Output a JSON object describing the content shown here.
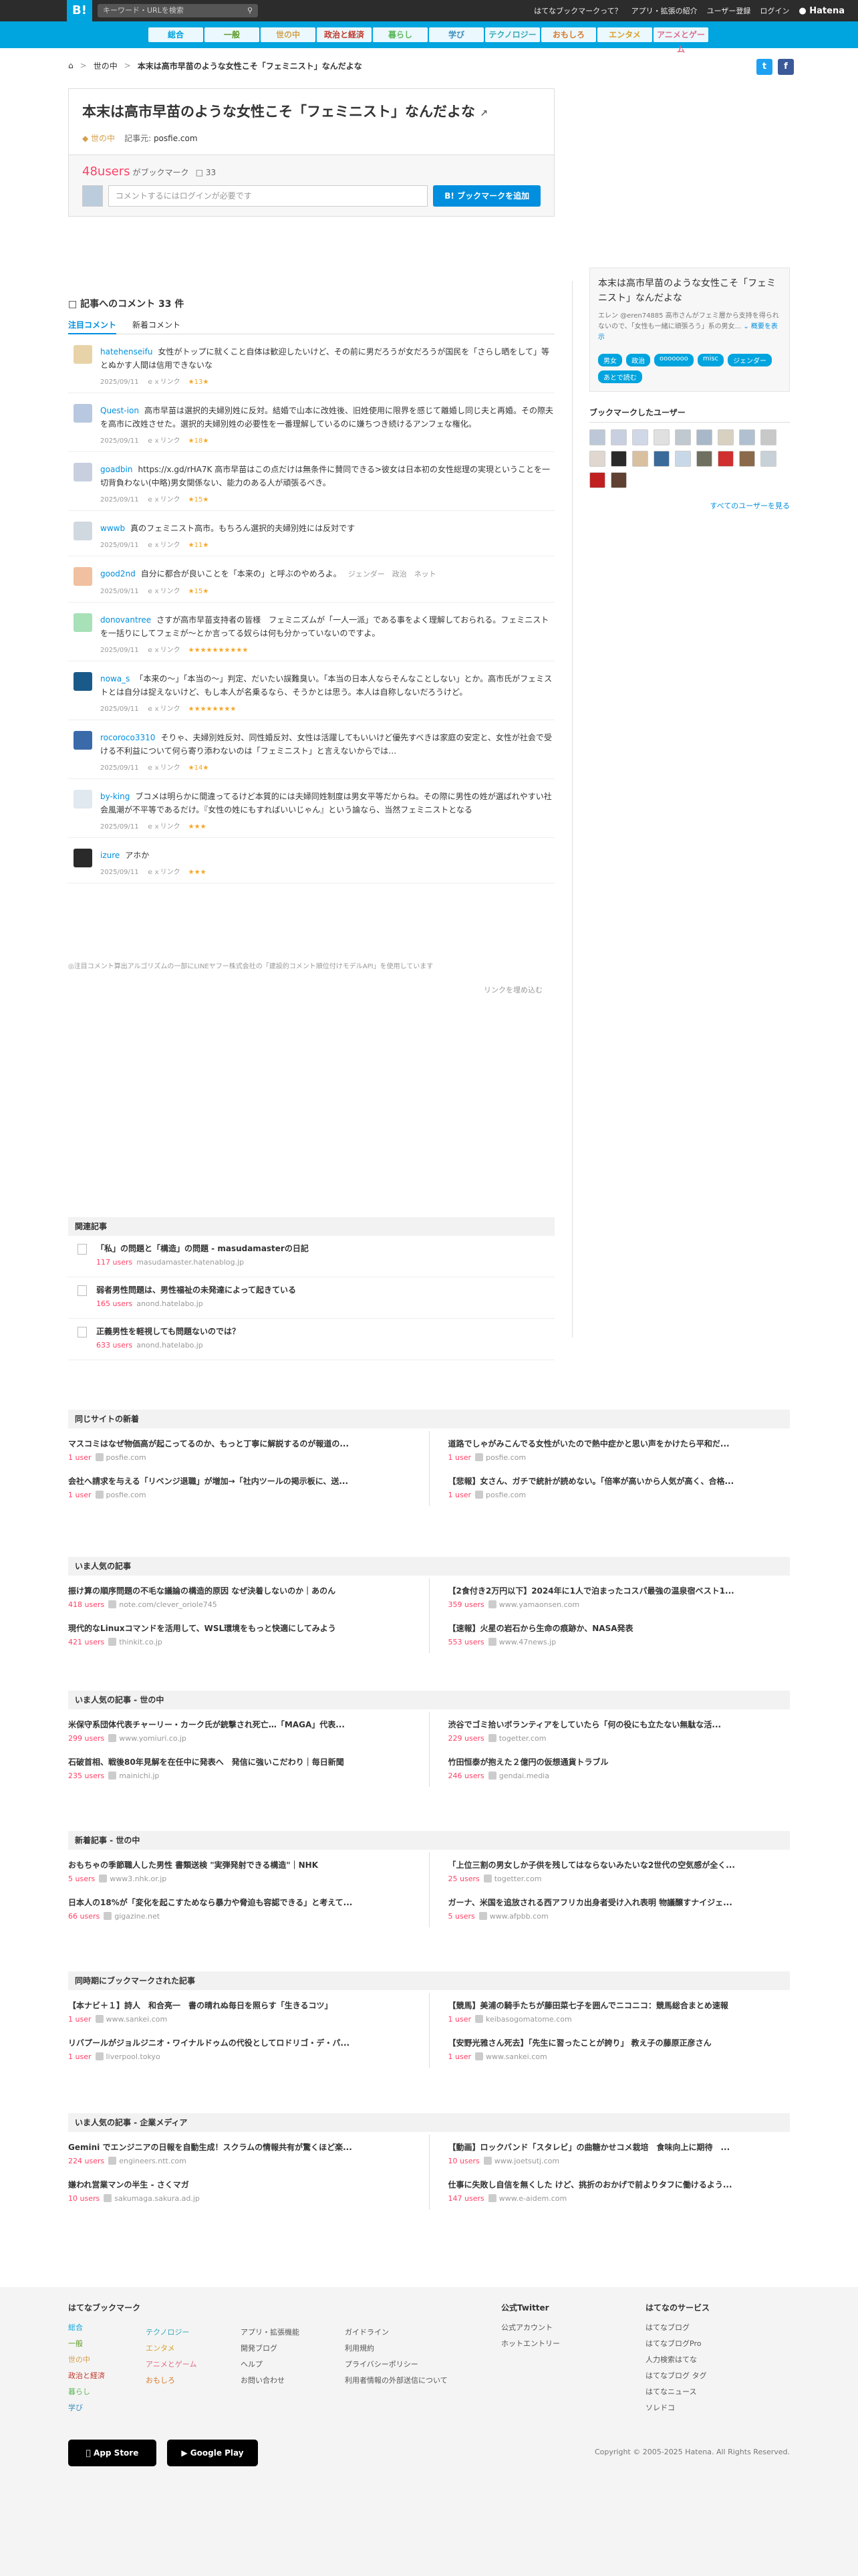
{
  "topbar": {
    "logo": "B!",
    "search_placeholder": "キーワード・URLを検索",
    "links": [
      "はてなブックマークって？",
      "アプリ・拡張の紹介",
      "ユーザー登録",
      "ログイン"
    ],
    "hatena": "Hatena"
  },
  "categories": [
    "総合",
    "一般",
    "世の中",
    "政治と経済",
    "暮らし",
    "学び",
    "テクノロジー",
    "おもしろ",
    "エンタメ",
    "アニメとゲーム"
  ],
  "category_colors": [
    "#00a4de",
    "#5b9a23",
    "#d4a04b",
    "#c0392b",
    "#5cb85c",
    "#3c8dbc",
    "#37a9b8",
    "#d97a2b",
    "#d9a12b",
    "#e06c8c"
  ],
  "breadcrumb": {
    "parent": "世の中",
    "title": "本末は高市早苗のような女性こそ「フェミニスト」なんだよな"
  },
  "entry": {
    "title": "本末は高市早苗のような女性こそ「フェミニスト」なんだよな",
    "category": "世の中",
    "kiji": "記事元:",
    "domain": "posfie.com",
    "users": "48users",
    "users_label": "がブックマーク",
    "comments_count": "33",
    "comment_placeholder": "コメントするにはログインが必要です",
    "add_button": "B! ブックマークを追加"
  },
  "comments_section": {
    "heading": "記事へのコメント",
    "count": "33 件",
    "tabs": [
      "注目コメント",
      "新着コメント"
    ]
  },
  "comments": [
    {
      "user": "hatehenseifu",
      "text": "女性がトップに就くこと自体は歓迎したいけど、その前に男だろうが女だろうが国民を「さらし晒をして」等とぬかす人間は信用できないな",
      "date": "2025/09/11",
      "stars": "★13★",
      "color": "#e8d3a8"
    },
    {
      "user": "Quest-ion",
      "text": "高市早苗は選択的夫婦別姓に反対。結婚で山本に改姓後、旧姓使用に限界を感じて離婚し同じ夫と再婚。その際夫を高市に改姓させた。選択的夫婦別姓の必要性を一番理解しているのに嫌ちつき続けるアンフェな権化。",
      "date": "2025/09/11",
      "stars": "★18★",
      "color": "#b8c8e0"
    },
    {
      "user": "goadbin",
      "text": "https://x.gd/rHA7K 高市早苗はこの点だけは無条件に賛同できる>彼女は日本初の女性総理の実現ということを一切背負わない(中略)男女関係ない、能力のある人が頑張るべき。",
      "date": "2025/09/11",
      "stars": "★15★",
      "color": "#c8d0e0"
    },
    {
      "user": "wwwb",
      "text": "真のフェミニスト高市。もちろん選択的夫婦別姓には反対です",
      "date": "2025/09/11",
      "stars": "★11★",
      "color": "#d0d8e0"
    },
    {
      "user": "good2nd",
      "text": "自分に都合が良いことを「本来の」と呼ぶのやめろよ。",
      "date": "2025/09/11",
      "stars": "★15★",
      "color": "#f0c0a0",
      "tags": "ジェンダー　政治　ネット"
    },
    {
      "user": "donovantree",
      "text": "さすが高市早苗支持者の皆様　フェミニズムが「一人一派」である事をよく理解しておられる。フェミニストを一括りにしてフェミが〜とか言ってる奴らは何も分かっていないのですよ。",
      "date": "2025/09/11",
      "stars": "★★★★★★★★★★",
      "color": "#a8e0b8"
    },
    {
      "user": "nowa_s",
      "text": "「本来の～」「本当の～」判定、だいたい誤難臭い。「本当の日本人ならそんなことしない」とか。高市氏がフェミストとは自分は捉えないけど、もし本人が名乗るなら、そうかとは思う。本人は自称しないだろうけど。",
      "date": "2025/09/11",
      "stars": "★★★★★★★★",
      "color": "#1a5a8a"
    },
    {
      "user": "rocoroco3310",
      "text": "そりゃ、夫婦別姓反対、同性婚反対、女性は活躍してもいいけど優先すべきは家庭の安定と、女性が社会で受ける不利益について何ら寄り添わないのは「フェミニスト」と言えないからでは…",
      "date": "2025/09/11",
      "stars": "★14★",
      "color": "#3a6aaa"
    },
    {
      "user": "by-king",
      "text": "ブコメは明らかに間違ってるけど本質的には夫婦同姓制度は男女平等だからね。その際に男性の姓が選ばれやすい社会風潮が不平等であるだけ。『女性の姓にもすればいいじゃん』という論なら、当然フェミニストとなる",
      "date": "2025/09/11",
      "stars": "★★★",
      "color": "#e0e8f0"
    },
    {
      "user": "izure",
      "text": "アホか",
      "date": "2025/09/11",
      "stars": "★★★",
      "color": "#2a2a2a"
    }
  ],
  "comment_link_label": "ｅｘリンク",
  "algo_note": "◎注目コメント算出アルゴリズムの一部にLINEヤフー株式会社の「建設的コメント順位付けモデルAPI」を使用しています",
  "more_comments": "リンクを埋め込む",
  "related": {
    "heading": "関連記事",
    "items": [
      {
        "title": "「私」の問題と「構造」の問題 - masudamasterの日記",
        "users": "117 users",
        "domain": "masudamaster.hatenablog.jp"
      },
      {
        "title": "弱者男性問題は、男性福祉の未発達によって起きている",
        "users": "165 users",
        "domain": "anond.hatelabo.jp"
      },
      {
        "title": "正義男性を軽視しても問題ないのでは？",
        "users": "633 users",
        "domain": "anond.hatelabo.jp"
      }
    ]
  },
  "sidebar": {
    "title": "本末は高市早苗のような女性こそ「フェミニスト」なんだよな",
    "desc": "エレン @eren74885 高市さんがフェミ層から支持を得られないので、「女性も一緒に頑張ろう」系の男女...",
    "desc_more": "概要を表示",
    "tags": [
      "男女",
      "政治",
      "ooooooo",
      "misc",
      "ジェンダー",
      "あとで読む"
    ],
    "users_heading": "ブックマークしたユーザー",
    "all_users": "すべてのユーザーを見る"
  },
  "sections": [
    {
      "heading": "同じサイトの新着",
      "left": [
        {
          "title": "マスコミはなぜ物価高が起こってるのか、もっと丁寧に解説するのが報道の...",
          "users": "1 user",
          "domain": "posfie.com"
        },
        {
          "title": "会社へ請求を与える「リベンジ退職」が増加→「社内ツールの掲示板に、送...",
          "users": "1 user",
          "domain": "posfie.com"
        }
      ],
      "right": [
        {
          "title": "道路でしゃがみこんでる女性がいたので熱中症かと思い声をかけたら平和だ...",
          "users": "1 user",
          "domain": "posfie.com"
        },
        {
          "title": "【悲報】女さん、ガチで統計が読めない。「倍率が高いから人気が高く、合格...",
          "users": "1 user",
          "domain": "posfie.com"
        }
      ]
    },
    {
      "heading": "いま人気の記事",
      "left": [
        {
          "title": "振け算の順序問題の不毛な議論の構造的原因 なぜ決着しないのか｜あのん",
          "users": "418 users",
          "domain": "note.com/clever_oriole745"
        },
        {
          "title": "現代的なLinuxコマンドを活用して、WSL環境をもっと快適にしてみよう",
          "users": "421 users",
          "domain": "thinkit.co.jp"
        }
      ],
      "right": [
        {
          "title": "【2食付き2万円以下】2024年に1人で泊まったコスパ最強の温泉宿ベスト1...",
          "users": "359 users",
          "domain": "www.yamaonsen.com"
        },
        {
          "title": "【速報】火星の岩石から生命の痕跡か、NASA発表",
          "users": "553 users",
          "domain": "www.47news.jp"
        }
      ]
    },
    {
      "heading": "いま人気の記事 - 世の中",
      "left": [
        {
          "title": "米保守系団体代表チャーリー・カーク氏が銃撃され死亡…「MAGA」代表...",
          "users": "299 users",
          "domain": "www.yomiuri.co.jp"
        },
        {
          "title": "石破首相、戦後80年見解を在任中に発表へ　発信に強いこだわり｜毎日新聞",
          "users": "235 users",
          "domain": "mainichi.jp"
        }
      ],
      "right": [
        {
          "title": "渋谷でゴミ拾いボランティアをしていたら「何の役にも立たない無駄な活...",
          "users": "229 users",
          "domain": "togetter.com"
        },
        {
          "title": "竹田恒泰が抱えた２億円の仮想通貨トラブル",
          "users": "246 users",
          "domain": "gendai.media"
        }
      ]
    },
    {
      "heading": "新着記事 - 世の中",
      "left": [
        {
          "title": "おもちゃの季節職人した男性 書類送検 \"実弾発射できる構造\"｜NHK",
          "users": "5 users",
          "domain": "www3.nhk.or.jp"
        },
        {
          "title": "日本人の18%が「変化を起こすためなら暴力や脅迫も容認できる」と考えて...",
          "users": "66 users",
          "domain": "gigazine.net"
        }
      ],
      "right": [
        {
          "title": "「上位三割の男女しか子供を残してはならないみたいな2世代の空気感が全く...",
          "users": "25 users",
          "domain": "togetter.com"
        },
        {
          "title": "ガーナ、米国を追放される西アフリカ出身者受け入れ表明 物議醸すナイジェ...",
          "users": "5 users",
          "domain": "www.afpbb.com"
        }
      ]
    },
    {
      "heading": "同時期にブックマークされた記事",
      "left": [
        {
          "title": "【本ナビ＋１】詩人　和合亮一　書の晴れぬ毎日を照らす「生きるコツ」",
          "users": "1 user",
          "domain": "www.sankei.com"
        },
        {
          "title": "リバプールがジョルジニオ・ワイナルドゥムの代役としてロドリゴ・デ・パ...",
          "users": "1 user",
          "domain": "liverpool.tokyo"
        }
      ],
      "right": [
        {
          "title": "【競馬】美浦の騎手たちが藤田菜七子を囲んでニコニコ：競馬総合まとめ速報",
          "users": "1 user",
          "domain": "keibasogomatome.com"
        },
        {
          "title": "【安野光雅さん死去】「先生に習ったことが誇り」 教え子の藤原正彦さん",
          "users": "1 user",
          "domain": "www.sankei.com"
        }
      ]
    },
    {
      "heading": "いま人気の記事 - 企業メディア",
      "left": [
        {
          "title": "Gemini でエンジニアの日報を自動生成！スクラムの情報共有が驚くほど楽...",
          "users": "224 users",
          "domain": "engineers.ntt.com"
        },
        {
          "title": "嫌われ営業マンの半生 - さくマガ",
          "users": "10 users",
          "domain": "sakumaga.sakura.ad.jp"
        }
      ],
      "right": [
        {
          "title": "【動画】ロックバンド「スタレビ」の曲糖かせコメ栽培　食味向上に期待　...",
          "users": "10 users",
          "domain": "www.joetsutj.com"
        },
        {
          "title": "仕事に失敗し自信を無くした けど、挑折のおかげで前よりタフに働けるよう...",
          "users": "147 users",
          "domain": "www.e-aidem.com"
        }
      ]
    }
  ],
  "footer": {
    "bm_heading": "はてなブックマーク",
    "bm_col1": [
      "総合",
      "一般",
      "世の中",
      "政治と経済",
      "暮らし",
      "学び"
    ],
    "bm_col2": [
      "テクノロジー",
      "エンタメ",
      "アニメとゲーム",
      "おもしろ"
    ],
    "bm_col3": [
      "アプリ・拡張機能",
      "開発ブログ",
      "ヘルプ",
      "お問い合わせ"
    ],
    "bm_col4": [
      "ガイドライン",
      "利用規約",
      "プライバシーポリシー",
      "利用者情報の外部送信について"
    ],
    "tw_heading": "公式Twitter",
    "tw_items": [
      "公式アカウント",
      "ホットエントリー"
    ],
    "svc_heading": "はてなのサービス",
    "svc_items": [
      "はてなブログ",
      "はてなブログPro",
      "人力検索はてな",
      "はてなブログ タグ",
      "はてなニュース",
      "ソレドコ"
    ],
    "appstore": "App Store",
    "googleplay": "Google Play",
    "copyright": "Copyright © 2005-2025 Hatena. All Rights Reserved."
  }
}
